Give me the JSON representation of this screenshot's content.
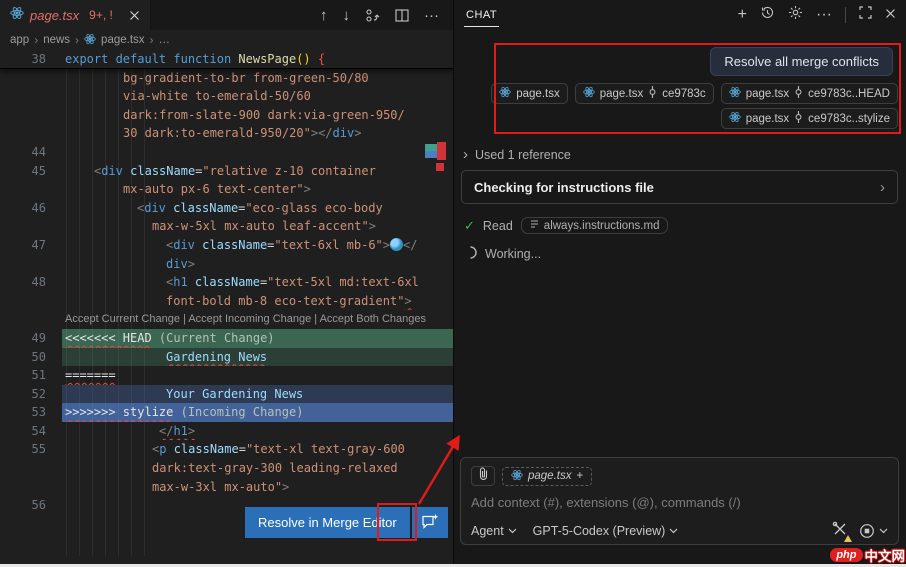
{
  "colors": {
    "accent_blue": "#2a6fb8",
    "annotation_red": "#e01b1b",
    "error_red": "#f14c4c",
    "current_change_green": "#3b6753",
    "incoming_change_blue": "#3f639a",
    "check_green": "#3fb950",
    "react_blue": "#58a6d8",
    "warning_yellow": "#e8c45c",
    "watermark_red": "#e21f1f"
  },
  "editor": {
    "tab": {
      "title": "page.tsx",
      "badge": "9+, !"
    },
    "breadcrumb": [
      "app",
      "news",
      "page.tsx",
      "…"
    ],
    "resolve_button_label": "Resolve in Merge Editor",
    "lines": [
      {
        "n": "38",
        "cls": "sticky",
        "segs": [
          {
            "c": "kw",
            "t": "export default function "
          },
          {
            "c": "fn",
            "t": "NewsPage"
          },
          {
            "c": "par",
            "t": "()"
          },
          {
            "c": "op",
            "t": " "
          },
          {
            "c": "brace",
            "t": "{"
          }
        ]
      },
      {
        "ind": 58,
        "segs": [
          {
            "c": "str",
            "t": "bg-gradient-to-br from-green-50/80"
          }
        ]
      },
      {
        "ind": 58,
        "segs": [
          {
            "c": "str",
            "t": "via-white to-emerald-50/60"
          }
        ]
      },
      {
        "ind": 58,
        "segs": [
          {
            "c": "str",
            "t": "dark:from-slate-900 dark:via-green-950/"
          }
        ]
      },
      {
        "ind": 58,
        "segs": [
          {
            "c": "str",
            "t": "30 dark:to-emerald-950/20\""
          },
          {
            "c": "pn",
            "t": "></"
          },
          {
            "c": "tag",
            "t": "div"
          },
          {
            "c": "pn",
            "t": ">"
          }
        ]
      },
      {
        "n": "44",
        "segs": []
      },
      {
        "n": "45",
        "ind": 29,
        "segs": [
          {
            "c": "pn",
            "t": "<"
          },
          {
            "c": "tag",
            "t": "div"
          },
          {
            "c": "attr",
            "t": " className"
          },
          {
            "c": "op",
            "t": "="
          },
          {
            "c": "str",
            "t": "\"relative z-10 container"
          }
        ]
      },
      {
        "ind": 58,
        "segs": [
          {
            "c": "str",
            "t": "mx-auto px-6 text-center\""
          },
          {
            "c": "pn",
            "t": ">"
          }
        ]
      },
      {
        "n": "46",
        "ind": 72,
        "segs": [
          {
            "c": "pn",
            "t": "<"
          },
          {
            "c": "tag",
            "t": "div"
          },
          {
            "c": "attr",
            "t": " className"
          },
          {
            "c": "op",
            "t": "="
          },
          {
            "c": "str",
            "t": "\"eco-glass eco-body"
          }
        ]
      },
      {
        "ind": 87,
        "segs": [
          {
            "c": "str",
            "t": "max-w-5xl mx-auto leaf-accent\""
          },
          {
            "c": "pn",
            "t": ">"
          }
        ]
      },
      {
        "n": "47",
        "ind": 101,
        "segs": [
          {
            "c": "pn",
            "t": "<"
          },
          {
            "c": "tag",
            "t": "div"
          },
          {
            "c": "attr",
            "t": " className"
          },
          {
            "c": "op",
            "t": "="
          },
          {
            "c": "str",
            "t": "\"text-6xl mb-6\""
          },
          {
            "c": "pn",
            "t": ">"
          },
          {
            "c": "globe",
            "t": "🌍"
          },
          {
            "c": "pn",
            "t": "</"
          }
        ]
      },
      {
        "ind": 101,
        "segs": [
          {
            "c": "tag",
            "t": "div"
          },
          {
            "c": "pn",
            "t": ">"
          }
        ]
      },
      {
        "n": "48",
        "ind": 101,
        "segs": [
          {
            "c": "pn",
            "t": "<"
          },
          {
            "c": "tag",
            "t": "h1"
          },
          {
            "c": "attr",
            "t": " className"
          },
          {
            "c": "op",
            "t": "="
          },
          {
            "c": "str",
            "t": "\"text-5xl md:text-6xl"
          }
        ]
      },
      {
        "ind": 101,
        "segs": [
          {
            "c": "str",
            "t": "font-bold mb-8 eco-text-gradient\""
          },
          {
            "c": "pn sq",
            "t": ">"
          }
        ]
      },
      {
        "cls": "lens",
        "segs": [
          {
            "c": "lens",
            "t": "Accept Current Change | Accept Incoming Change | Accept Both Changes"
          }
        ]
      },
      {
        "n": "49",
        "cls": "cur-head",
        "segs": [
          {
            "c": "mk sq",
            "t": "<<<<<<< HEAD"
          },
          {
            "c": "meta",
            "t": " (Current Change)"
          }
        ]
      },
      {
        "n": "50",
        "cls": "cur-body",
        "ind": 101,
        "segs": [
          {
            "c": "txt sq",
            "t": "Gardening News"
          }
        ]
      },
      {
        "n": "51",
        "segs": [
          {
            "c": "mk sq",
            "t": "======="
          }
        ]
      },
      {
        "n": "52",
        "cls": "inc-body",
        "ind": 101,
        "segs": [
          {
            "c": "txt",
            "t": "Your Gardening News"
          }
        ]
      },
      {
        "n": "53",
        "cls": "inc-head",
        "segs": [
          {
            "c": "mk sq",
            "t": ">>>>>>> stylize"
          },
          {
            "c": "meta",
            "t": " (Incoming Change)"
          }
        ]
      },
      {
        "n": "54",
        "ind": 94,
        "segs": [
          {
            "c": "pn sq",
            "t": "</"
          },
          {
            "c": "tag sq",
            "t": "h1"
          },
          {
            "c": "pn sq",
            "t": ">"
          }
        ]
      },
      {
        "n": "55",
        "ind": 87,
        "segs": [
          {
            "c": "pn",
            "t": "<"
          },
          {
            "c": "tag",
            "t": "p"
          },
          {
            "c": "attr",
            "t": " className"
          },
          {
            "c": "op",
            "t": "="
          },
          {
            "c": "str",
            "t": "\"text-xl text-gray-600"
          }
        ]
      },
      {
        "ind": 87,
        "segs": [
          {
            "c": "str",
            "t": "dark:text-gray-300 leading-relaxed"
          }
        ]
      },
      {
        "ind": 87,
        "segs": [
          {
            "c": "str",
            "t": "max-w-3xl mx-auto\""
          },
          {
            "c": "pn",
            "t": ">"
          }
        ]
      },
      {
        "n": "56",
        "segs": []
      },
      {
        "segs": []
      },
      {
        "segs": []
      }
    ]
  },
  "chat": {
    "tab_label": "CHAT",
    "request_message": "Resolve all merge conflicts",
    "chip_rows": [
      [
        {
          "file": "page.tsx"
        },
        {
          "file": "page.tsx",
          "ref": "ce9783c"
        },
        {
          "file": "page.tsx",
          "ref": "ce9783c..HEAD"
        }
      ],
      [
        {
          "file": "page.tsx",
          "ref": "ce9783c..stylize"
        }
      ]
    ],
    "used_reference": "Used 1 reference",
    "progress_title": "Checking for instructions file",
    "read_label": "Read",
    "read_file": "always.instructions.md",
    "working_label": "Working...",
    "input": {
      "context_chip": "page.tsx",
      "context_add": "+",
      "placeholder": "Add context (#), extensions (@), commands (/)",
      "agent_label": "Agent",
      "model_label": "GPT-5-Codex (Preview)"
    }
  },
  "watermark": {
    "badge": "php",
    "text": "中文网"
  }
}
